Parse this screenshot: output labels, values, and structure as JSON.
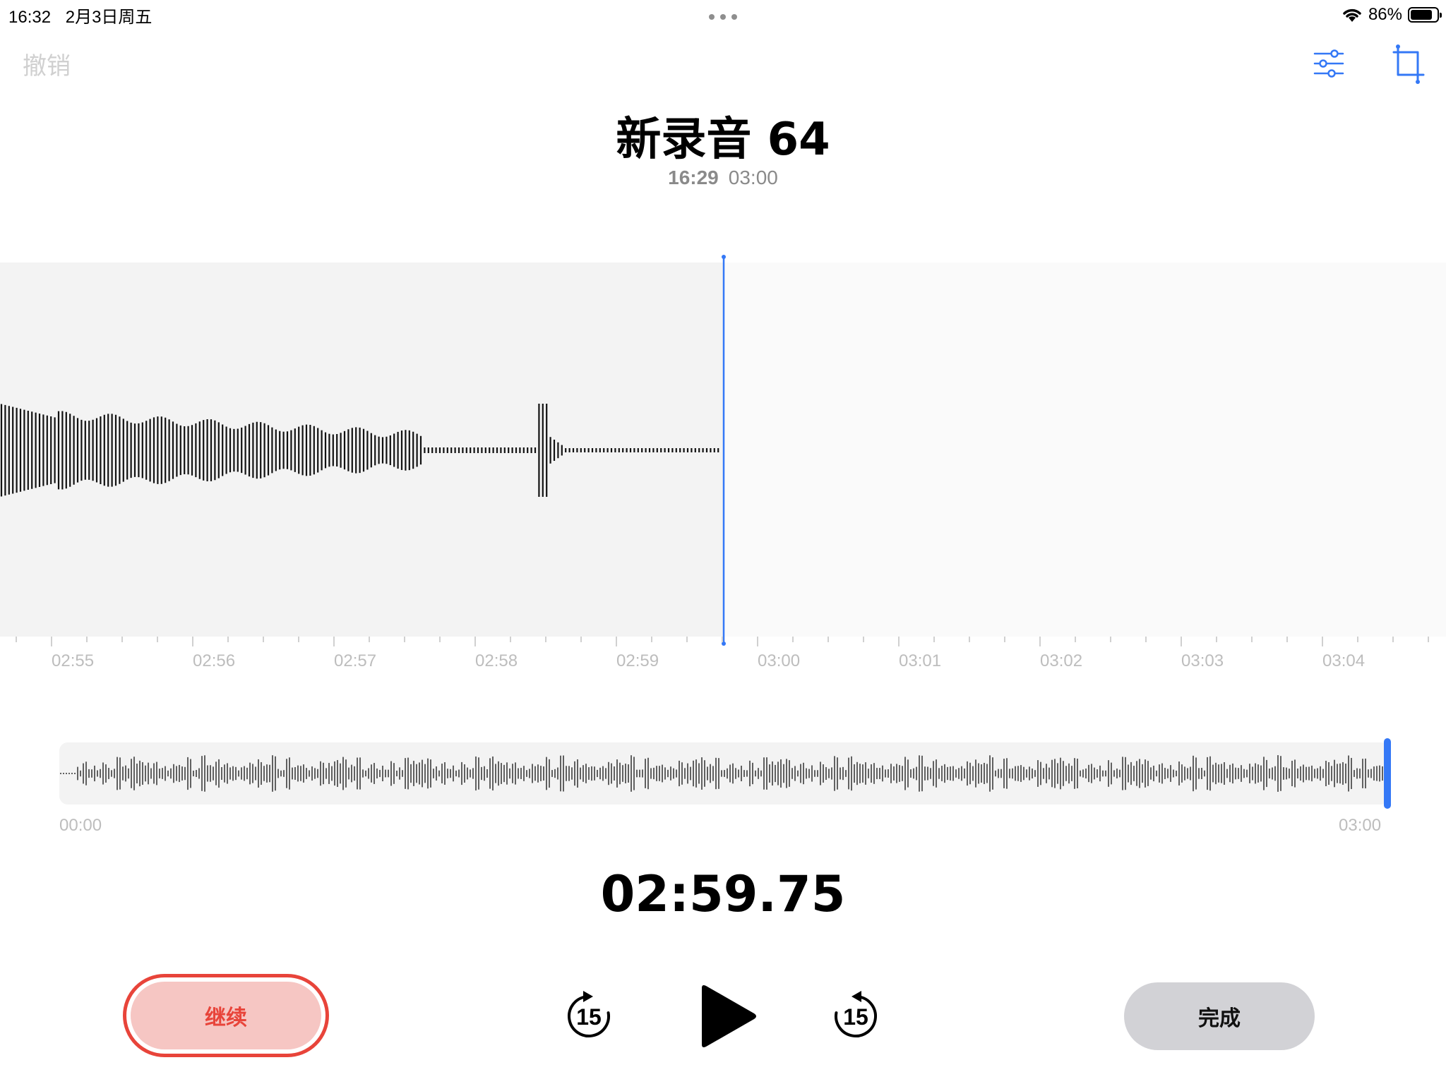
{
  "status_bar": {
    "time": "16:32",
    "date": "2月3日周五",
    "battery_text": "86%",
    "battery_level": 0.86
  },
  "toolbar": {
    "undo_label": "撤销"
  },
  "recording": {
    "title": "新录音 64",
    "start_time": "16:29",
    "duration": "03:00"
  },
  "timeline": {
    "labels": [
      "02:55",
      "02:56",
      "02:57",
      "02:58",
      "02:59",
      "03:00",
      "03:01",
      "03:02",
      "03:03",
      "03:04"
    ]
  },
  "overview": {
    "start_label": "00:00",
    "end_label": "03:00",
    "position": 1.0
  },
  "playback": {
    "current_time": "02:59.75",
    "skip_back_label": "15",
    "skip_forward_label": "15"
  },
  "buttons": {
    "resume_label": "继续",
    "done_label": "完成"
  },
  "colors": {
    "accent": "#3478f6",
    "record_red": "#e8443a",
    "resume_fill": "#f6c6c3",
    "done_fill": "#d2d2d6"
  },
  "icons": {
    "filter": "sliders-icon",
    "crop": "trim-icon",
    "play": "play-icon",
    "skip_back": "skip-back-15-icon",
    "skip_forward": "skip-forward-15-icon",
    "wifi": "wifi-icon",
    "battery": "battery-icon",
    "multitask": "more-dots-icon"
  }
}
